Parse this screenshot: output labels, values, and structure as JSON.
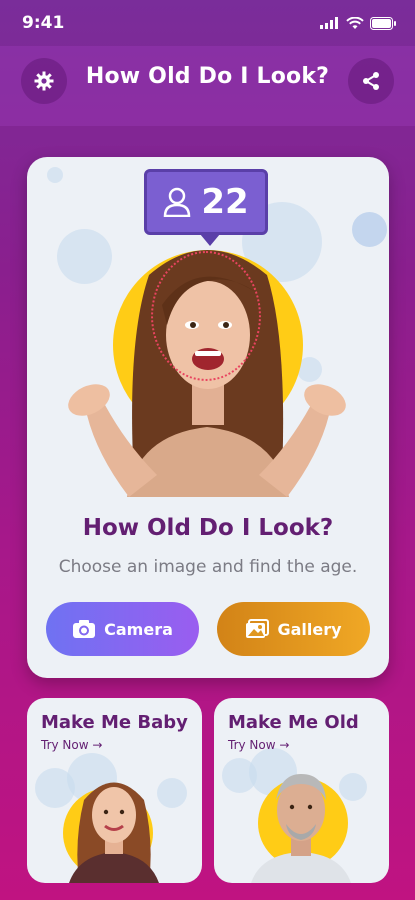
{
  "status": {
    "time": "9:41"
  },
  "header": {
    "title": "How Old Do I Look?"
  },
  "main_card": {
    "age": "22",
    "title": "How Old Do I Look?",
    "subtitle": "Choose an image and find the age.",
    "camera_label": "Camera",
    "gallery_label": "Gallery"
  },
  "features": [
    {
      "title": "Make Me Baby",
      "link": "Try Now →"
    },
    {
      "title": "Make Me Old",
      "link": "Try Now →"
    }
  ]
}
